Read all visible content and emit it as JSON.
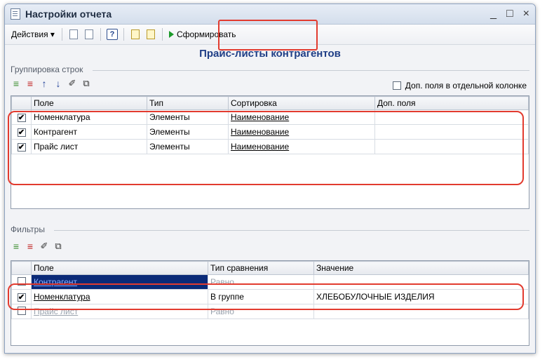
{
  "window": {
    "title": "Настройки отчета",
    "controls": {
      "minimize": "_",
      "maximize": "□",
      "close": "×"
    }
  },
  "toolbar": {
    "actions_label": "Действия ▾",
    "help_label": "?",
    "generate_label": "Сформировать"
  },
  "report_title": "Прайс-листы контрагентов",
  "grouping": {
    "section_label": "Группировка строк",
    "extra_fields_label": "Доп. поля в отдельной колонке",
    "extra_fields_checked": false,
    "columns": [
      "Поле",
      "Тип",
      "Сортировка",
      "Доп. поля"
    ],
    "rows": [
      {
        "checked": true,
        "field": "Номенклатура",
        "type": "Элементы",
        "sort": "Наименование",
        "extra": ""
      },
      {
        "checked": true,
        "field": "Контрагент",
        "type": "Элементы",
        "sort": "Наименование",
        "extra": ""
      },
      {
        "checked": true,
        "field": "Прайс лист",
        "type": "Элементы",
        "sort": "Наименование",
        "extra": ""
      }
    ]
  },
  "filters": {
    "section_label": "Фильтры",
    "columns": [
      "Поле",
      "Тип сравнения",
      "Значение"
    ],
    "rows": [
      {
        "checked": false,
        "field": "Контрагент",
        "comparison": "Равно",
        "value": ""
      },
      {
        "checked": true,
        "field": "Номенклатура",
        "comparison": "В группе",
        "value": "ХЛЕБОБУЛОЧНЫЕ ИЗДЕЛИЯ"
      },
      {
        "checked": false,
        "field": "Прайс лист",
        "comparison": "Равно",
        "value": ""
      }
    ]
  },
  "icons": {
    "add": "add-row-icon",
    "delete": "delete-row-icon",
    "up": "move-up-icon",
    "down": "move-down-icon",
    "mark": "check-all-icon",
    "copy": "copy-icon"
  },
  "colors": {
    "accent_title": "#1f3e86",
    "highlight": "#e23b2f",
    "selection": "#0a2a78"
  }
}
